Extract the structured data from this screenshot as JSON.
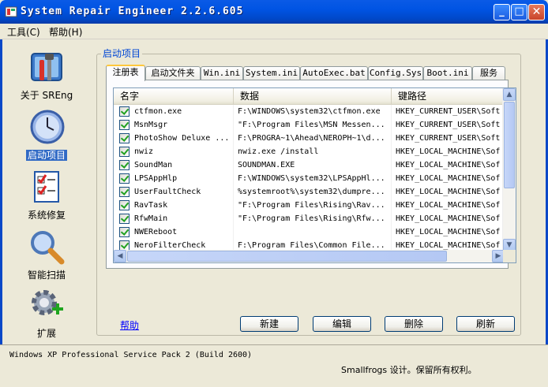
{
  "window": {
    "title": "System Repair Engineer 2.2.6.605",
    "minimize": "_",
    "maximize": "□",
    "close": "✕"
  },
  "menu": [
    {
      "label": "工具(C)"
    },
    {
      "label": "帮助(H)"
    }
  ],
  "sidebar": [
    {
      "label": "关于 SREng",
      "icon": "toolbox-icon"
    },
    {
      "label": "启动项目",
      "icon": "clock-icon",
      "active": true
    },
    {
      "label": "系统修复",
      "icon": "checklist-icon"
    },
    {
      "label": "智能扫描",
      "icon": "magnifier-icon"
    },
    {
      "label": "扩展",
      "icon": "gear-plus-icon"
    }
  ],
  "group": {
    "title": "启动项目"
  },
  "tabs": [
    {
      "label": "注册表",
      "active": true
    },
    {
      "label": "启动文件夹"
    },
    {
      "label": "Win.ini"
    },
    {
      "label": "System.ini"
    },
    {
      "label": "AutoExec.bat"
    },
    {
      "label": "Config.Sys"
    },
    {
      "label": "Boot.ini"
    },
    {
      "label": "服务"
    }
  ],
  "table": {
    "columns": [
      "名字",
      "数据",
      "键路径"
    ],
    "rows": [
      {
        "name": "ctfmon.exe",
        "data": "F:\\WINDOWS\\system32\\ctfmon.exe",
        "path": "HKEY_CURRENT_USER\\Soft"
      },
      {
        "name": "MsnMsgr",
        "data": "\"F:\\Program Files\\MSN Messen...",
        "path": "HKEY_CURRENT_USER\\Soft"
      },
      {
        "name": "PhotoShow Deluxe ...",
        "data": "F:\\PROGRA~1\\Ahead\\NEROPH~1\\d...",
        "path": "HKEY_CURRENT_USER\\Soft"
      },
      {
        "name": "nwiz",
        "data": "nwiz.exe /install",
        "path": "HKEY_LOCAL_MACHINE\\Sof"
      },
      {
        "name": "SoundMan",
        "data": "SOUNDMAN.EXE",
        "path": "HKEY_LOCAL_MACHINE\\Sof"
      },
      {
        "name": "LPSAppHlp",
        "data": "F:\\WINDOWS\\system32\\LPSAppHl...",
        "path": "HKEY_LOCAL_MACHINE\\Sof"
      },
      {
        "name": "UserFaultCheck",
        "data": "%systemroot%\\system32\\dumpre...",
        "path": "HKEY_LOCAL_MACHINE\\Sof"
      },
      {
        "name": "RavTask",
        "data": "\"F:\\Program Files\\Rising\\Rav...",
        "path": "HKEY_LOCAL_MACHINE\\Sof"
      },
      {
        "name": "RfwMain",
        "data": "\"F:\\Program Files\\Rising\\Rfw...",
        "path": "HKEY_LOCAL_MACHINE\\Sof"
      },
      {
        "name": "NWEReboot",
        "data": "",
        "path": "HKEY_LOCAL_MACHINE\\Sof"
      },
      {
        "name": "NeroFilterCheck",
        "data": "F:\\Program Files\\Common File...",
        "path": "HKEY_LOCAL_MACHINE\\Sof"
      }
    ]
  },
  "actions": {
    "help": "帮助",
    "add": "新建",
    "edit": "编辑",
    "delete": "删除",
    "refresh": "刷新"
  },
  "status": {
    "os": "Windows XP Professional Service Pack 2 (Build 2600)",
    "copyright": "Smallfrogs 设计。保留所有权利。"
  }
}
